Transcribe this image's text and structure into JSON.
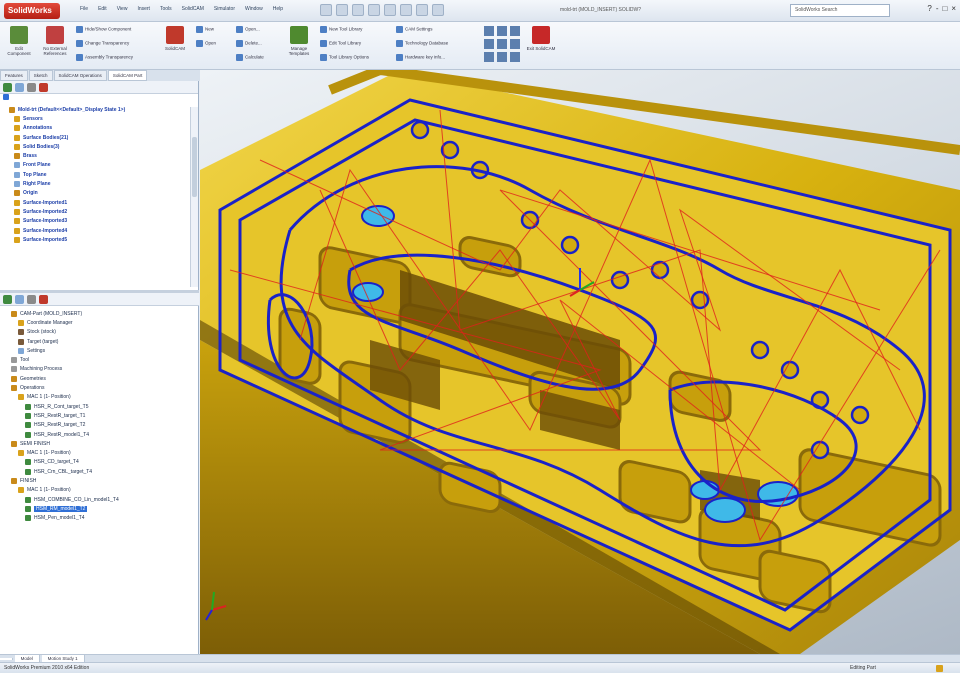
{
  "app": {
    "logo_text": "SolidWorks",
    "menus": [
      "File",
      "Edit",
      "View",
      "Insert",
      "Tools",
      "SolidCAM",
      "Simulator",
      "Window",
      "Help"
    ],
    "document_title": "mold-trt (MOLD_INSERT) SOLIDW?",
    "search_placeholder": "SolidWorks Search",
    "window_buttons": [
      "?",
      "-",
      "□",
      "×"
    ]
  },
  "ribbon": {
    "big_buttons": [
      {
        "label": "Edit Component",
        "icon": "edit-component-icon",
        "color": "#5a8c3a"
      },
      {
        "label": "No External References",
        "icon": "no-external-references-icon",
        "color": "#c04040"
      },
      {
        "label": "SolidCAM",
        "icon": "solidcam-icon",
        "color": "#c0392b"
      },
      {
        "label": "Manage Templates",
        "icon": "manage-templates-icon",
        "color": "#4f8a2f"
      },
      {
        "label": "Exit SolidCAM",
        "icon": "exit-solidcam-icon",
        "color": "#c62828"
      }
    ],
    "small_items": [
      "Hide/Show Component",
      "Change Transparency",
      "Assembly Transparency",
      "New",
      "Open",
      "Open...",
      "Delete...",
      "Calculate",
      "New Tool Library",
      "Edit Tool Library",
      "Tool Library Options",
      "CAM Settings",
      "Technology Database",
      "Hardware key info..."
    ]
  },
  "command_tabs": [
    "Features",
    "Sketch",
    "SolidCAM Operations",
    "SolidCAM Part"
  ],
  "feature_tree": [
    {
      "label": "Mold-trt (Default<<Default>_Display State 1>)",
      "color": "#c98a1a"
    },
    {
      "label": "Sensors",
      "color": "#d9a21b"
    },
    {
      "label": "Annotations",
      "color": "#d9a21b"
    },
    {
      "label": "Surface Bodies(21)",
      "color": "#d9a21b"
    },
    {
      "label": "Solid Bodies(3)",
      "color": "#d9a21b"
    },
    {
      "label": "Brass",
      "color": "#c98a1a"
    },
    {
      "label": "Front Plane",
      "color": "#7fa7d6"
    },
    {
      "label": "Top Plane",
      "color": "#7fa7d6"
    },
    {
      "label": "Right Plane",
      "color": "#7fa7d6"
    },
    {
      "label": "Origin",
      "color": "#c98a1a"
    },
    {
      "label": "Surface-Imported1",
      "color": "#d9a21b"
    },
    {
      "label": "Surface-Imported2",
      "color": "#d9a21b"
    },
    {
      "label": "Surface-Imported3",
      "color": "#d9a21b"
    },
    {
      "label": "Surface-Imported4",
      "color": "#d9a21b"
    },
    {
      "label": "Surface-Imported5",
      "color": "#d9a21b"
    }
  ],
  "cam_tree": [
    {
      "label": "CAM-Part (MOLD_INSERT)",
      "color": "#c98a1a",
      "indent": 1
    },
    {
      "label": "Coordinate Manager",
      "color": "#d9a21b",
      "indent": 2
    },
    {
      "label": "Stock (stock)",
      "color": "#7a5a3a",
      "indent": 2
    },
    {
      "label": "Target (target)",
      "color": "#7a5a3a",
      "indent": 2
    },
    {
      "label": "Settings",
      "color": "#7fa7d6",
      "indent": 2
    },
    {
      "label": "Tool",
      "color": "#999999",
      "indent": 1
    },
    {
      "label": "Machining Process",
      "color": "#999999",
      "indent": 1
    },
    {
      "label": "Geometries",
      "color": "#c98a1a",
      "indent": 1
    },
    {
      "label": "Operations",
      "color": "#c98a1a",
      "indent": 1
    },
    {
      "label": "MAC 1 (1- Position)",
      "color": "#d9a21b",
      "indent": 2
    },
    {
      "label": "HSR_R_Cont_target_T5",
      "color": "#3f8a3f",
      "indent": 3
    },
    {
      "label": "HSR_RestR_target_T1",
      "color": "#3f8a3f",
      "indent": 3
    },
    {
      "label": "HSR_RestR_target_T2",
      "color": "#3f8a3f",
      "indent": 3
    },
    {
      "label": "HSR_RestR_model1_T4",
      "color": "#3f8a3f",
      "indent": 3
    },
    {
      "label": "SEMI FINISH",
      "color": "#c98a1a",
      "indent": 1
    },
    {
      "label": "MAC 1 (1- Position)",
      "color": "#d9a21b",
      "indent": 2
    },
    {
      "label": "HSR_CD_target_T4",
      "color": "#3f8a3f",
      "indent": 3
    },
    {
      "label": "HSR_Crn_CBL_target_T4",
      "color": "#3f8a3f",
      "indent": 3
    },
    {
      "label": "FINISH",
      "color": "#c98a1a",
      "indent": 1
    },
    {
      "label": "MAC 1 (1- Position)",
      "color": "#d9a21b",
      "indent": 2
    },
    {
      "label": "HSM_COMBINE_CO_Lin_model1_T4",
      "color": "#3f8a3f",
      "indent": 3
    },
    {
      "label": "HSM_RM_model1_T2",
      "color": "#3f8a3f",
      "indent": 3,
      "selected": true
    },
    {
      "label": "HSM_Pen_model1_T4",
      "color": "#3f8a3f",
      "indent": 3
    }
  ],
  "bottom_tabs": [
    "",
    "Model",
    "Motion Study 1"
  ],
  "status": {
    "left": "SolidWorks Premium 2010 x64 Edition",
    "right": "Editing Part"
  },
  "colors": {
    "part": "#d9b512",
    "part_shadow": "#8a6a0a",
    "toolpath_blue": "#1a22c8",
    "toolpath_red": "#e0201c",
    "pocket_cyan": "#3fb9e8"
  }
}
